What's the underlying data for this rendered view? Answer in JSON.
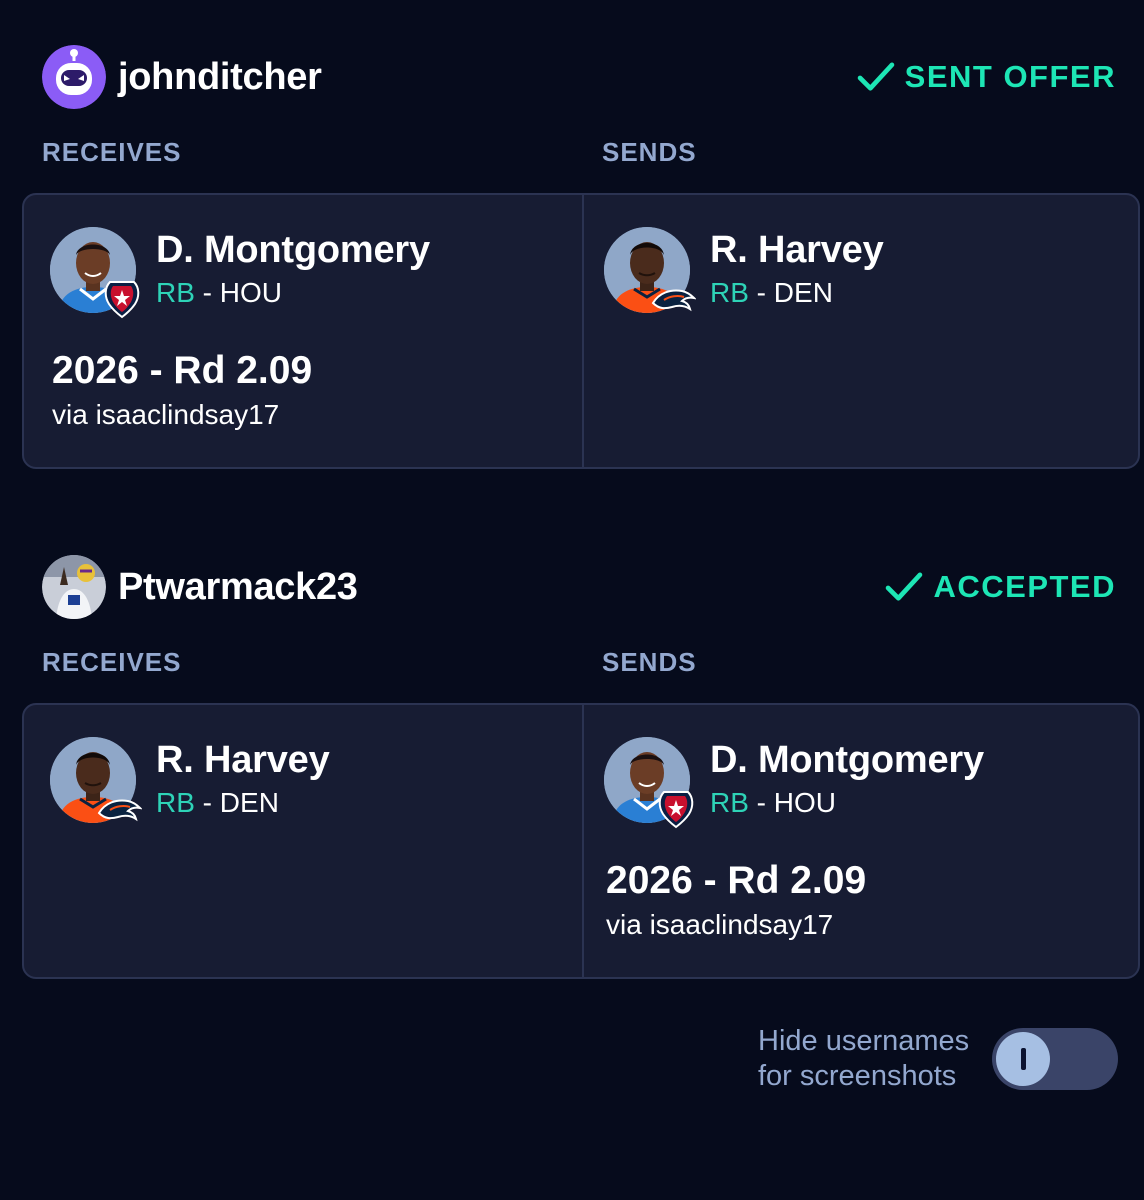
{
  "trades": [
    {
      "username": "johnditcher",
      "status": "SENT OFFER",
      "receives_label": "RECEIVES",
      "sends_label": "SENDS",
      "receives": {
        "player": {
          "name": "D. Montgomery",
          "position": "RB",
          "team_sep": " - ",
          "team": "HOU"
        },
        "pick": {
          "title": "2026 - Rd 2.09",
          "via": "via isaaclindsay17"
        }
      },
      "sends": {
        "player": {
          "name": "R. Harvey",
          "position": "RB",
          "team_sep": " - ",
          "team": "DEN"
        }
      }
    },
    {
      "username": "Ptwarmack23",
      "status": "ACCEPTED",
      "receives_label": "RECEIVES",
      "sends_label": "SENDS",
      "receives": {
        "player": {
          "name": "R. Harvey",
          "position": "RB",
          "team_sep": " - ",
          "team": "DEN"
        }
      },
      "sends": {
        "player": {
          "name": "D. Montgomery",
          "position": "RB",
          "team_sep": " - ",
          "team": "HOU"
        },
        "pick": {
          "title": "2026 - Rd 2.09",
          "via": "via isaaclindsay17"
        }
      }
    }
  ],
  "settings": {
    "hide_usernames_line1": "Hide usernames",
    "hide_usernames_line2": "for screenshots",
    "hide_usernames_enabled": false
  },
  "colors": {
    "background": "#060b1c",
    "card": "#171c33",
    "accent": "#1de6b5",
    "position": "#2ed3b7",
    "label": "#93a8cf"
  },
  "icons": {
    "status": "checkmark-icon",
    "user1_avatar": "robot-avatar-icon",
    "texans": "houston-texans-logo-icon",
    "broncos": "denver-broncos-logo-icon"
  }
}
